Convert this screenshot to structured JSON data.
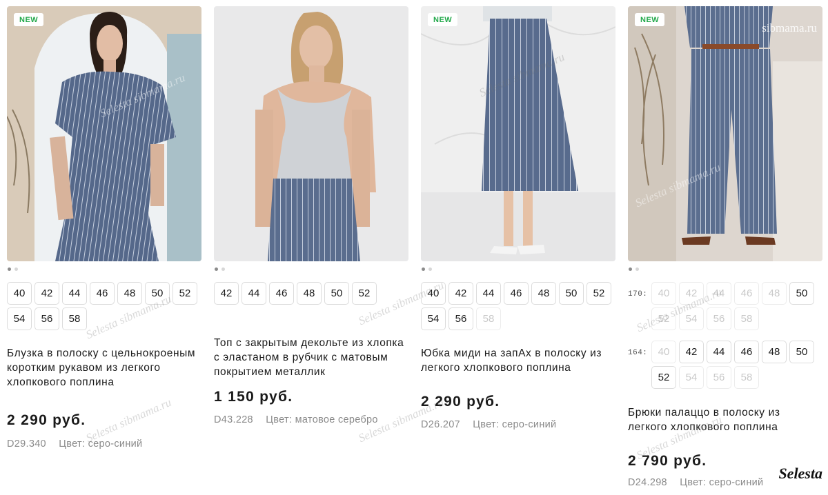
{
  "products": [
    {
      "badge": "NEW",
      "title": "Блузка в полоску с цельнокроеным коротким рукавом из легкого хлопкового поплина",
      "price": "2 290 руб.",
      "sku": "D29.340",
      "color": "Цвет: серо-синий",
      "sizes": [
        "40",
        "42",
        "44",
        "46",
        "48",
        "50",
        "52",
        "54",
        "56",
        "58"
      ]
    },
    {
      "badge": "",
      "title": "Топ с закрытым декольте из хлопка с эластаном в рубчик с матовым покрытием металлик",
      "price": "1 150 руб.",
      "sku": "D43.228",
      "color": "Цвет: матовое серебро",
      "sizes": [
        "42",
        "44",
        "46",
        "48",
        "50",
        "52"
      ]
    },
    {
      "badge": "NEW",
      "title": "Юбка миди на запАх в полоску из легкого хлопкового поплина",
      "price": "2 290 руб.",
      "sku": "D26.207",
      "color": "Цвет: серо-синий",
      "sizes": [
        "40",
        "42",
        "44",
        "46",
        "48",
        "50",
        "52",
        "54",
        "56",
        "58"
      ],
      "sizes_unavailable": [
        "58"
      ]
    },
    {
      "badge": "NEW",
      "title": "Брюки палаццо в полоску из легкого хлопкового поплина",
      "price": "2 790 руб.",
      "sku": "D24.298",
      "color": "Цвет: серо-синий",
      "height_groups": [
        {
          "label": "170:",
          "sizes": [
            "40",
            "42",
            "44",
            "46",
            "48",
            "50",
            "52",
            "54",
            "56",
            "58"
          ],
          "available": [
            "50"
          ]
        },
        {
          "label": "164:",
          "sizes": [
            "40",
            "42",
            "44",
            "46",
            "48",
            "50",
            "52",
            "54",
            "56",
            "58"
          ],
          "available": [
            "42",
            "44",
            "46",
            "48",
            "50",
            "52"
          ]
        }
      ]
    }
  ],
  "watermarks": {
    "site": "sibmama.ru",
    "selesta_site": "Selesta sibmama.ru",
    "signature": "Selesta"
  },
  "colors": {
    "badge_text": "#22a84a",
    "fabric": "#56688a",
    "stripe": "#c9d2e2"
  }
}
